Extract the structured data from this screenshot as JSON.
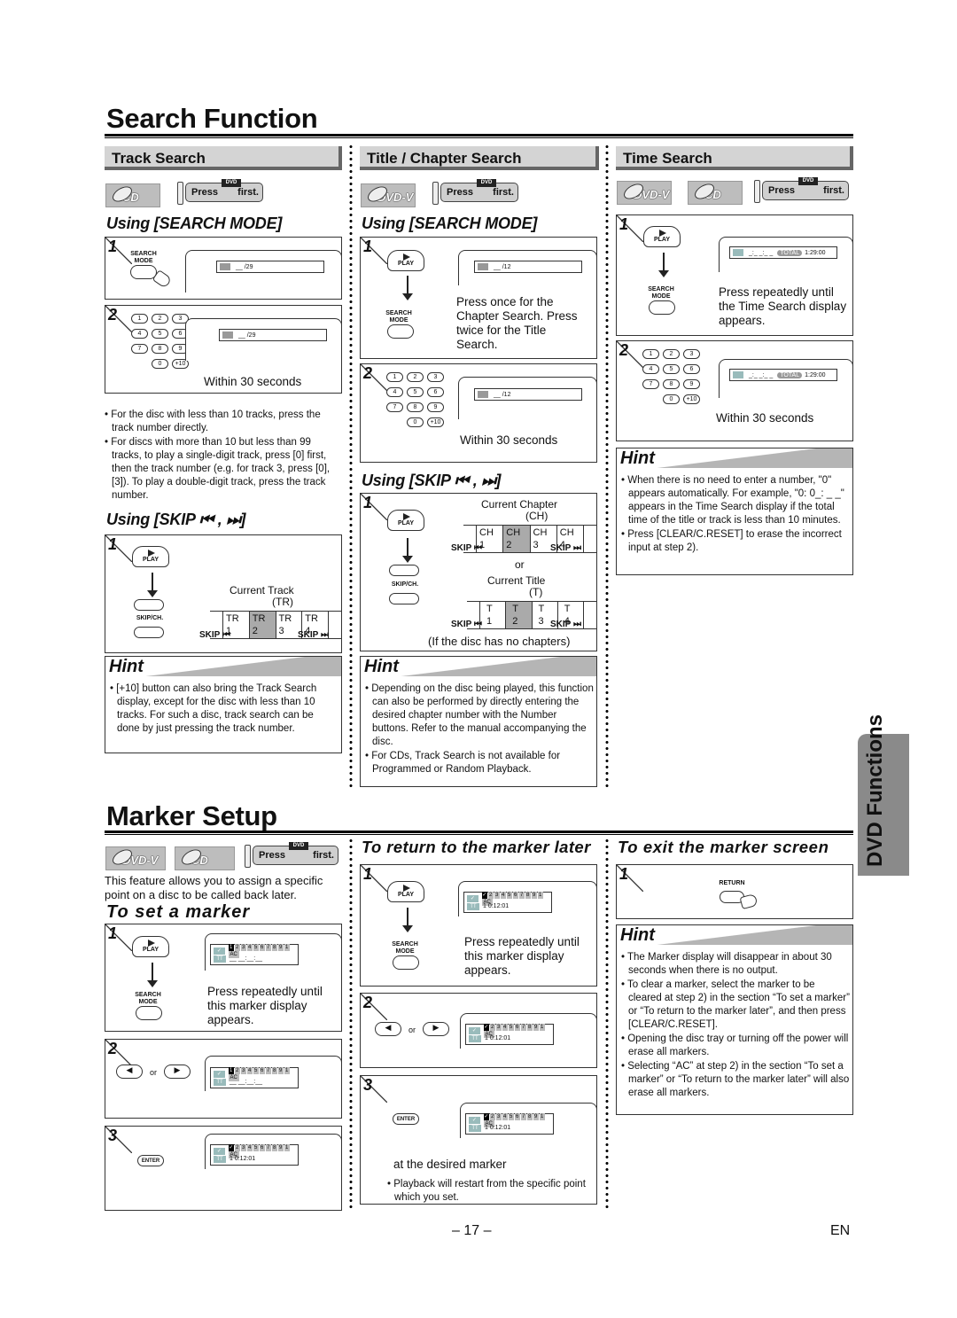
{
  "search_function": {
    "title": "Search Function",
    "track_search": {
      "header": "Track Search",
      "disc": "CD",
      "press_pre": "Press",
      "press_btn": "DVD",
      "press_post": "first.",
      "mode_heading": "Using [SEARCH MODE]",
      "step1": {
        "num": "1",
        "button": "SEARCH MODE",
        "osd_tag": "TR",
        "osd": "__ /29"
      },
      "step2": {
        "num": "2",
        "keys": [
          "1",
          "2",
          "3",
          "4",
          "5",
          "6",
          "7",
          "8",
          "9",
          "0",
          "+10"
        ],
        "osd_tag": "TR",
        "osd": "__ /29",
        "caption": "Within 30 seconds"
      },
      "notes": [
        "For the disc with less than 10 tracks, press the track number directly.",
        "For discs with more than 10 but less than 99 tracks, to play a single-digit track, press [0] first, then the track number (e.g. for track 3, press [0], [3]). To play a double-digit track, press the track number."
      ],
      "skip_heading": "Using [SKIP ⏮ , ⏭]",
      "skip_step": {
        "num": "1",
        "play": "PLAY",
        "skipch": "SKIP/CH.",
        "label1": "Current Track",
        "label2": "(TR)",
        "cells": [
          "TR 1",
          "TR 2",
          "TR 3",
          "TR 4"
        ],
        "current_index": 1,
        "skip_back": "SKIP ⏮",
        "skip_fwd": "SKIP ⏭"
      },
      "hint_title": "Hint",
      "hint": [
        "[+10] button can also bring the Track Search display, except for the disc with less than 10 tracks.  For such a disc, track search can be done by just pressing the track number."
      ]
    },
    "chapter_search": {
      "header": "Title / Chapter Search",
      "disc": "DVD-V",
      "press_pre": "Press",
      "press_btn": "DVD",
      "press_post": "first.",
      "mode_heading": "Using [SEARCH MODE]",
      "step1": {
        "num": "1",
        "play": "PLAY",
        "button": "SEARCH MODE",
        "osd_tag": "CH",
        "osd": "__ /12",
        "caption": "Press once for the Chapter Search. Press twice for the Title Search."
      },
      "step2": {
        "num": "2",
        "keys": [
          "1",
          "2",
          "3",
          "4",
          "5",
          "6",
          "7",
          "8",
          "9",
          "0",
          "+10"
        ],
        "osd_tag": "CH",
        "osd": "__ /12",
        "caption": "Within 30 seconds"
      },
      "skip_heading": "Using [SKIP ⏮ , ⏭]",
      "skip_step": {
        "num": "1",
        "play": "PLAY",
        "skipch": "SKIP/CH.",
        "ch_label1": "Current Chapter",
        "ch_label2": "(CH)",
        "ch_cells": [
          "CH 1",
          "CH 2",
          "CH 3",
          "CH 4"
        ],
        "or": "or",
        "t_label1": "Current Title",
        "t_label2": "(T)",
        "t_cells": [
          "T 1",
          "T 2",
          "T 3",
          "T 4"
        ],
        "current_index": 1,
        "skip_back": "SKIP ⏮",
        "skip_fwd": "SKIP ⏭",
        "note": "(If the disc has no chapters)"
      },
      "hint_title": "Hint",
      "hint": [
        "Depending on the disc being played, this function can also be performed by directly entering the desired chapter number with the Number buttons. Refer to the manual accompanying the disc.",
        "For CDs, Track Search is not available for Programmed or Random Playback."
      ]
    },
    "time_search": {
      "header": "Time Search",
      "discs": [
        "DVD-V",
        "CD"
      ],
      "press_pre": "Press",
      "press_btn": "DVD",
      "press_post": "first.",
      "step1": {
        "num": "1",
        "play": "PLAY",
        "button": "SEARCH MODE",
        "osd": "_:_ _:_ _",
        "total_tag": "TOTAL",
        "total": "1:29:00",
        "caption": "Press repeatedly until the Time Search display appears."
      },
      "step2": {
        "num": "2",
        "keys": [
          "1",
          "2",
          "3",
          "4",
          "5",
          "6",
          "7",
          "8",
          "9",
          "0",
          "+10"
        ],
        "osd": "_:_ _:_ _",
        "total_tag": "TOTAL",
        "total": "1:29:00",
        "caption": "Within 30 seconds"
      },
      "hint_title": "Hint",
      "hint": [
        "When there is no need to enter a number, \"0\" appears automatically. For example, \"0: 0_: _ _\" appears in the Time Search display if the total time of the title or track is less than 10 minutes.",
        "Press [CLEAR/C.RESET] to erase the incorrect input at step 2)."
      ]
    }
  },
  "marker_setup": {
    "title": "Marker Setup",
    "discs": [
      "DVD-V",
      "CD"
    ],
    "press_pre": "Press",
    "press_btn": "DVD",
    "press_post": "first.",
    "intro": "This feature allows you to assign a specific point on a disc to be called back later.",
    "set": {
      "heading": "To set a marker",
      "step1": {
        "num": "1",
        "play": "PLAY",
        "button": "SEARCH MODE",
        "marker_cells": "1234567891AC",
        "marker_time": "__ __:__:__",
        "caption": "Press repeatedly until this marker display appears."
      },
      "step2": {
        "num": "2",
        "or": "or",
        "marker_cells": "1234567891AC",
        "marker_time": "__ __:__:__"
      },
      "step3": {
        "num": "3",
        "button": "ENTER",
        "marker_cells": "✓234567891AC",
        "marker_time": "1  0:12:01"
      }
    },
    "return": {
      "heading": "To return to the marker later",
      "step1": {
        "num": "1",
        "play": "PLAY",
        "button": "SEARCH MODE",
        "marker_cells": "✓234567891AC",
        "marker_time": "1  0:12:01",
        "caption": "Press repeatedly until this marker display appears."
      },
      "step2": {
        "num": "2",
        "or": "or",
        "marker_cells": "✓234567891AC",
        "marker_time": "1  0:12:01"
      },
      "step3": {
        "num": "3",
        "button": "ENTER",
        "marker_cells": "✓234567891AC",
        "marker_time": "1  0:12:01",
        "caption": "at the desired marker",
        "note": "Playback will restart from the specific point which you set."
      }
    },
    "exit": {
      "heading": "To exit the marker screen",
      "step1": {
        "num": "1",
        "button": "RETURN"
      },
      "hint_title": "Hint",
      "hint": [
        "The Marker display will disappear in about 30 seconds when there is no output.",
        "To clear a marker, select the marker to be cleared at step 2) in the section “To set a marker” or “To return to the marker later”, and then press [CLEAR/C.RESET].",
        "Opening the disc tray or turning off the power will erase all markers.",
        "Selecting “AC” at step 2) in the section “To set a marker” or “To return to the marker later” will also erase all markers."
      ]
    }
  },
  "side_tab": "DVD Functions",
  "footer": {
    "page": "– 17 –",
    "lang": "EN"
  }
}
